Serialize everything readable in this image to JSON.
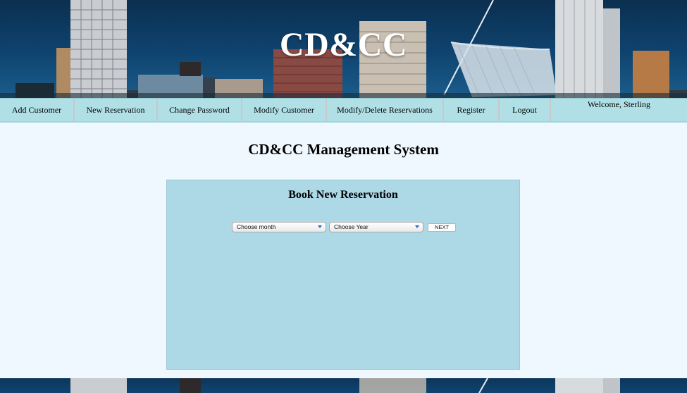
{
  "header": {
    "site_title": "CD&CC"
  },
  "nav": {
    "items": [
      {
        "label": "Add Customer"
      },
      {
        "label": "New Reservation"
      },
      {
        "label": "Change Password"
      },
      {
        "label": "Modify Customer"
      },
      {
        "label": "Modify/Delete Reservations"
      },
      {
        "label": "Register"
      },
      {
        "label": "Logout"
      }
    ],
    "welcome": "Welcome, Sterling"
  },
  "main": {
    "page_title": "CD&CC Management System",
    "panel": {
      "title": "Book New Reservation",
      "month_select": {
        "selected": "Choose month"
      },
      "year_select": {
        "selected": "Choose Year"
      },
      "next_button": "NEXT"
    }
  },
  "colors": {
    "page_bg": "#f0f8ff",
    "nav_bg": "#b0e0e6",
    "panel_bg": "#add8e6",
    "header_bg": "#0f4470"
  }
}
